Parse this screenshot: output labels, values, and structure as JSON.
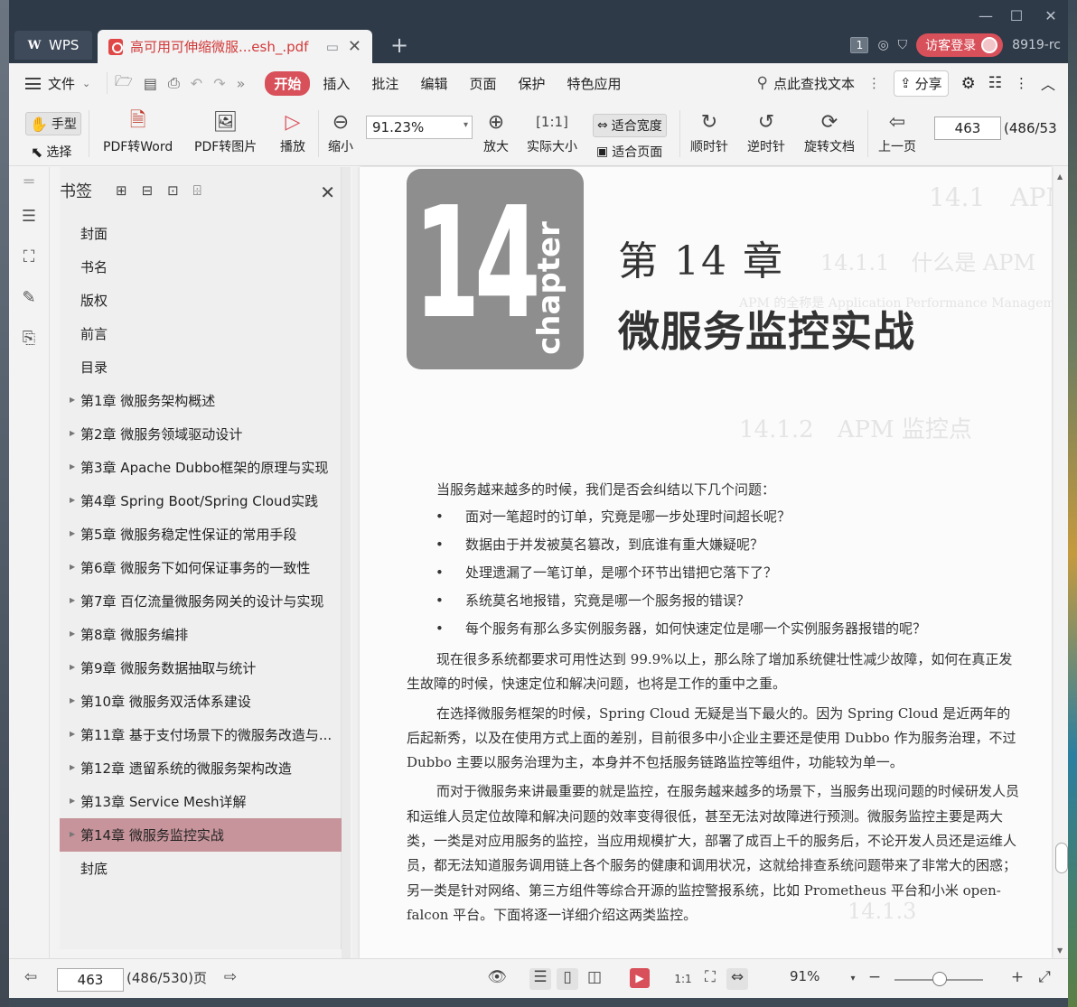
{
  "titlebar": {
    "app_tab": "WPS",
    "doc_tab": "高可用可伸缩微服...esh_.pdf",
    "count_badge": "1",
    "login_button": "访客登录",
    "user": "8919-rc"
  },
  "menubar": {
    "file": "文件",
    "tabs": [
      "开始",
      "插入",
      "批注",
      "编辑",
      "页面",
      "保护",
      "特色应用"
    ],
    "search": "点此查找文本",
    "share": "分享"
  },
  "ribbon": {
    "hand": "手型",
    "select": "选择",
    "pdf_to_word": "PDF转Word",
    "pdf_to_image": "PDF转图片",
    "play": "播放",
    "zoom_out": "缩小",
    "zoom_value": "91.23%",
    "zoom_in": "放大",
    "actual_size": "实际大小",
    "fit_width": "适合宽度",
    "fit_page": "适合页面",
    "rotate_cw": "顺时针",
    "rotate_ccw": "逆时针",
    "rotate_doc": "旋转文档",
    "prev_page": "上一页",
    "page_current": "463",
    "page_total": "(486/53"
  },
  "bookmarks": {
    "title": "书签",
    "items": [
      {
        "label": "封面",
        "expandable": false,
        "selected": false
      },
      {
        "label": "书名",
        "expandable": false,
        "selected": false
      },
      {
        "label": "版权",
        "expandable": false,
        "selected": false
      },
      {
        "label": "前言",
        "expandable": false,
        "selected": false
      },
      {
        "label": "目录",
        "expandable": false,
        "selected": false
      },
      {
        "label": "第1章  微服务架构概述",
        "expandable": true,
        "selected": false
      },
      {
        "label": "第2章  微服务领域驱动设计",
        "expandable": true,
        "selected": false
      },
      {
        "label": "第3章  Apache Dubbo框架的原理与实现",
        "expandable": true,
        "selected": false
      },
      {
        "label": "第4章  Spring Boot/Spring Cloud实践",
        "expandable": true,
        "selected": false
      },
      {
        "label": "第5章  微服务稳定性保证的常用手段",
        "expandable": true,
        "selected": false
      },
      {
        "label": "第6章  微服务下如何保证事务的一致性",
        "expandable": true,
        "selected": false
      },
      {
        "label": "第7章  百亿流量微服务网关的设计与实现",
        "expandable": true,
        "selected": false
      },
      {
        "label": "第8章  微服务编排",
        "expandable": true,
        "selected": false
      },
      {
        "label": "第9章  微服务数据抽取与统计",
        "expandable": true,
        "selected": false
      },
      {
        "label": "第10章  微服务双活体系建设",
        "expandable": true,
        "selected": false
      },
      {
        "label": "第11章  基于支付场景下的微服务改造与...",
        "expandable": true,
        "selected": false
      },
      {
        "label": "第12章  遗留系统的微服务架构改造",
        "expandable": true,
        "selected": false
      },
      {
        "label": "第13章  Service Mesh详解",
        "expandable": true,
        "selected": false
      },
      {
        "label": "第14章  微服务监控实战",
        "expandable": true,
        "selected": true
      },
      {
        "label": "封底",
        "expandable": false,
        "selected": false
      }
    ]
  },
  "page": {
    "chapter_number": "14",
    "chapter_word": "chapter",
    "chapter_label": "第 14 章",
    "chapter_title": "微服务监控实战",
    "intro": "当服务越来越多的时候，我们是否会纠结以下几个问题：",
    "bullets": [
      "面对一笔超时的订单，究竟是哪一步处理时间超长呢？",
      "数据由于并发被莫名篡改，到底谁有重大嫌疑呢？",
      "处理遗漏了一笔订单，是哪个环节出错把它落下了？",
      "系统莫名地报错，究竟是哪一个服务报的错误？",
      "每个服务有那么多实例服务器，如何快速定位是哪一个实例服务器报错的呢？"
    ],
    "para1": "现在很多系统都要求可用性达到 99.9%以上，那么除了增加系统健壮性减少故障，如何在真正发生故障的时候，快速定位和解决问题，也将是工作的重中之重。",
    "para2": "在选择微服务框架的时候，Spring Cloud 无疑是当下最火的。因为 Spring Cloud 是近两年的后起新秀，以及在使用方式上面的差别，目前很多中小企业主要还是使用 Dubbo 作为服务治理，不过 Dubbo 主要以服务治理为主，本身并不包括服务链路监控等组件，功能较为单一。",
    "para3": "而对于微服务来讲最重要的就是监控，在服务越来越多的场景下，当服务出现问题的时候研发人员和运维人员定位故障和解决问题的效率变得很低，甚至无法对故障进行预测。微服务监控主要是两大类，一类是对应用服务的监控，当应用规模扩大，部署了成百上千的服务后，不论开发人员还是运维人员，都无法知道服务调用链上各个服务的健康和调用状况，这就给排查系统问题带来了非常大的困惑；另一类是针对网络、第三方组件等综合开源的监控警报系统，比如 Prometheus 平台和小米 open-falcon 平台。下面将逐一详细介绍这两类监控。"
  },
  "statusbar": {
    "page_current": "463",
    "page_total": "(486/530)页",
    "zoom": "91%"
  }
}
